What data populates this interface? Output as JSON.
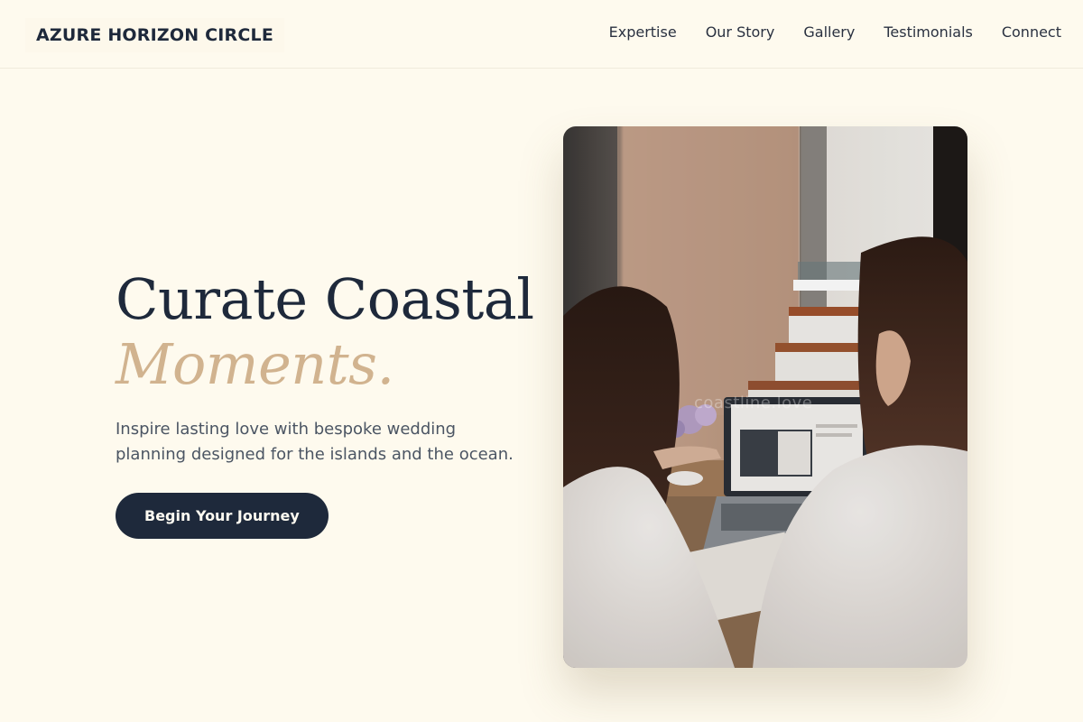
{
  "brand": {
    "name": "AZURE HORIZON CIRCLE"
  },
  "nav": {
    "links": [
      "Expertise",
      "Our Story",
      "Gallery",
      "Testimonials",
      "Connect"
    ]
  },
  "hero": {
    "headline_line1": "Curate Coastal",
    "headline_line2": "Moments.",
    "subtitle": "Inspire lasting love with bespoke wedding planning designed for the islands and the ocean.",
    "cta_label": "Begin Your Journey"
  },
  "photo": {
    "watermark": "coastline.love",
    "description_icon": "photo-two-women-laptop"
  },
  "colors": {
    "background": "#fefaee",
    "primary": "#1e293b",
    "accent": "#d1b38f",
    "muted_text": "#4b5563"
  }
}
